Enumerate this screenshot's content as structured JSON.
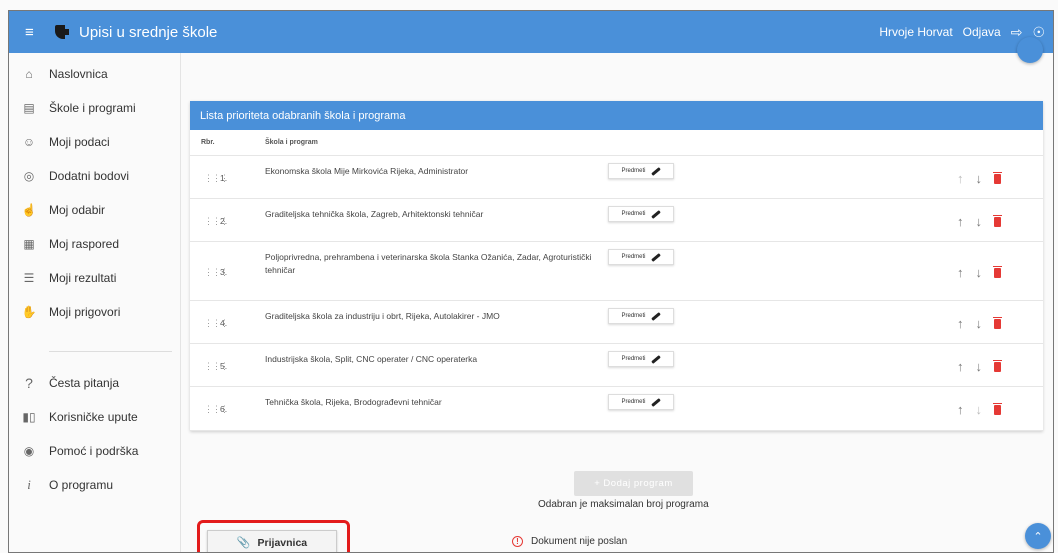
{
  "topbar": {
    "app_title": "Upisi u srednje škole",
    "user_name": "Hrvoje Horvat",
    "logout_label": "Odjava"
  },
  "sidebar": {
    "items": [
      {
        "label": "Naslovnica",
        "icon": "home-icon"
      },
      {
        "label": "Škole i programi",
        "icon": "building-icon"
      },
      {
        "label": "Moji podaci",
        "icon": "person-icon"
      },
      {
        "label": "Dodatni bodovi",
        "icon": "badge-icon"
      },
      {
        "label": "Moj odabir",
        "icon": "hand-pointer-icon"
      },
      {
        "label": "Moj raspored",
        "icon": "calendar-icon"
      },
      {
        "label": "Moji rezultati",
        "icon": "list-icon"
      },
      {
        "label": "Moji prigovori",
        "icon": "hand-icon"
      }
    ],
    "help_items": [
      {
        "label": "Česta pitanja",
        "icon": "question-icon"
      },
      {
        "label": "Korisničke upute",
        "icon": "book-icon"
      },
      {
        "label": "Pomoć i podrška",
        "icon": "support-icon"
      },
      {
        "label": "O programu",
        "icon": "info-icon"
      }
    ]
  },
  "main": {
    "card_title": "Lista prioriteta odabranih škola i programa",
    "columns": [
      "Rbr.",
      "Škola i program"
    ],
    "subjects_button_label": "Predmeti",
    "rows": [
      {
        "num": "1.",
        "name": "Ekonomska škola Mije Mirkovića Rijeka, Administrator"
      },
      {
        "num": "2.",
        "name": "Graditeljska tehnička škola, Zagreb, Arhitektonski tehničar"
      },
      {
        "num": "3.",
        "name": "Poljoprivredna, prehrambena i veterinarska škola Stanka Ožanića, Zadar, Agroturistički tehničar"
      },
      {
        "num": "4.",
        "name": "Graditeljska škola za industriju i obrt, Rijeka, Autolakirer - JMO"
      },
      {
        "num": "5.",
        "name": "Industrijska škola, Split, CNC operater / CNC operaterka"
      },
      {
        "num": "6.",
        "name": "Tehnička škola, Rijeka, Brodograđevni tehničar"
      }
    ],
    "add_button_label": "+ Dodaj program",
    "max_message": "Odabran je maksimalan broj programa",
    "application_button_label": "Prijavnica",
    "document_status": "Dokument nije poslan"
  },
  "colors": {
    "primary": "#4a90d9",
    "delete": "#e53935",
    "highlight": "#e31b1b"
  }
}
